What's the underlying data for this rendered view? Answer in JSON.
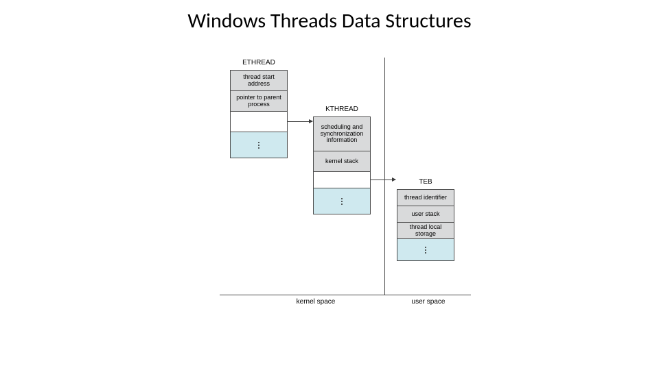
{
  "title": "Windows Threads Data Structures",
  "labels": {
    "ethread": "ETHREAD",
    "kthread": "KTHREAD",
    "teb": "TEB",
    "kernel_space": "kernel space",
    "user_space": "user space"
  },
  "ethread": {
    "cells": {
      "start_addr": "thread start address",
      "parent_ptr": "pointer to parent process"
    }
  },
  "kthread": {
    "cells": {
      "sched": "scheduling and synchronization information",
      "kstack": "kernel stack"
    }
  },
  "teb": {
    "cells": {
      "tid": "thread identifier",
      "ustack": "user stack",
      "tls": "thread local storage"
    }
  }
}
